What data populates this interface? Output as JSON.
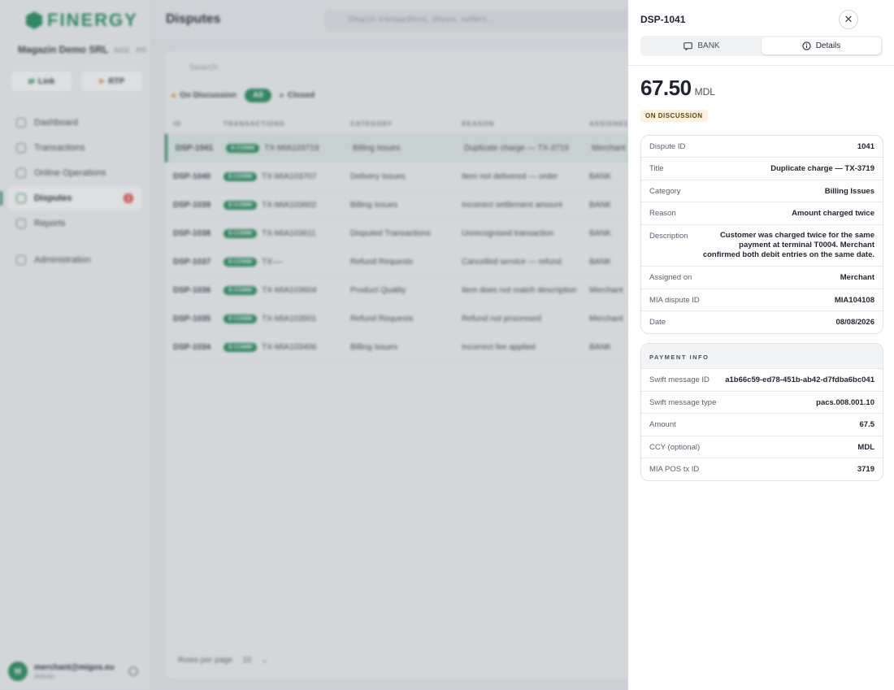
{
  "app": {
    "brand": "FINERGY",
    "merchant": {
      "name": "Magazin Demo SRL",
      "tag1": "MSE",
      "tag2": "RR"
    },
    "buttons": {
      "link": "Link",
      "rtp": "RTP"
    },
    "nav": [
      {
        "label": "Dashboard"
      },
      {
        "label": "Transactions"
      },
      {
        "label": "Online Operations"
      },
      {
        "label": "Disputes",
        "badge": "2"
      },
      {
        "label": "Reports"
      },
      {
        "label": "Administration"
      }
    ],
    "user": {
      "initial": "M",
      "email": "merchant@migos.eu",
      "role": "Admin"
    },
    "page_title": "Disputes",
    "top_search_placeholder": "Search transactions, stores, sellers...",
    "list_search_placeholder": "Search",
    "filters": {
      "open": "On Discussion",
      "all": "All",
      "closed": "Closed"
    },
    "columns": [
      "ID",
      "TRANSACTIONS",
      "CATEGORY",
      "REASON",
      "ASSIGNED"
    ],
    "rows": [
      {
        "id": "DSP-1041",
        "chip": "E-COMM",
        "tx": "TX-MIA103719",
        "category": "Billing Issues",
        "reason": "Duplicate charge — TX-3719",
        "assigned": "Merchant"
      },
      {
        "id": "DSP-1040",
        "chip": "E-COMM",
        "tx": "TX-MIA103707",
        "category": "Delivery Issues",
        "reason": "Item not delivered — order",
        "assigned": "BANK"
      },
      {
        "id": "DSP-1039",
        "chip": "E-COMM",
        "tx": "TX-MIA103602",
        "category": "Billing Issues",
        "reason": "Incorrect settlement amount",
        "assigned": "BANK"
      },
      {
        "id": "DSP-1038",
        "chip": "E-COMM",
        "tx": "TX-MIA103611",
        "category": "Disputed Transactions",
        "reason": "Unrecognised transaction",
        "assigned": "BANK"
      },
      {
        "id": "DSP-1037",
        "chip": "E-COMM",
        "tx": "TX-—",
        "category": "Refund Requests",
        "reason": "Cancelled service — refund",
        "assigned": "BANK"
      },
      {
        "id": "DSP-1036",
        "chip": "E-COMM",
        "tx": "TX-MIA103604",
        "category": "Product Quality",
        "reason": "Item does not match description",
        "assigned": "Merchant"
      },
      {
        "id": "DSP-1035",
        "chip": "E-COMM",
        "tx": "TX-MIA103501",
        "category": "Refund Requests",
        "reason": "Refund not processed",
        "assigned": "Merchant"
      },
      {
        "id": "DSP-1034",
        "chip": "E-COMM",
        "tx": "TX-MIA103406",
        "category": "Billing Issues",
        "reason": "Incorrect fee applied",
        "assigned": "BANK"
      }
    ],
    "rows_per_page_label": "Rows per page",
    "rows_per_page_value": "10"
  },
  "drawer": {
    "title": "DSP-1041",
    "tabs": {
      "bank": "BANK",
      "details": "Details"
    },
    "amount": "67.50",
    "currency": "MDL",
    "status": "ON DISCUSSION",
    "details": [
      {
        "key": "Dispute ID",
        "value": "1041"
      },
      {
        "key": "Title",
        "value": "Duplicate charge — TX-3719"
      },
      {
        "key": "Category",
        "value": "Billing Issues"
      },
      {
        "key": "Reason",
        "value": "Amount charged twice"
      },
      {
        "key": "Description",
        "value": "Customer was charged twice for the same payment at terminal T0004. Merchant confirmed both debit entries on the same date."
      },
      {
        "key": "Assigned on",
        "value": "Merchant"
      },
      {
        "key": "MIA dispute ID",
        "value": "MIA104108"
      },
      {
        "key": "Date",
        "value": "08/08/2026"
      }
    ],
    "payment_info_title": "PAYMENT INFO",
    "payment_info": [
      {
        "key": "Swift message ID",
        "value": "a1b66c59-ed78-451b-ab42-d7fdba6bc041"
      },
      {
        "key": "Swift message type",
        "value": "pacs.008.001.10"
      },
      {
        "key": "Amount",
        "value": "67.5"
      },
      {
        "key": "CCY (optional)",
        "value": "MDL"
      },
      {
        "key": "MIA POS tx ID",
        "value": "3719"
      }
    ]
  }
}
